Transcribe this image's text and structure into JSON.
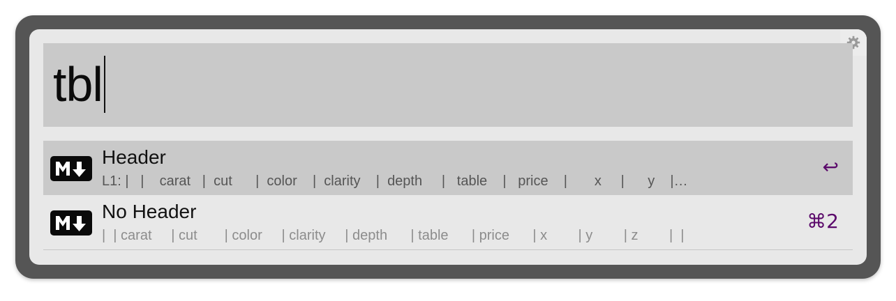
{
  "search": {
    "query": "tbl"
  },
  "settings_icon": "gear-icon",
  "results": [
    {
      "icon": "markdown-icon",
      "title": "Header",
      "subtitle": "L1: |   |    carat   |  cut      |  color    |  clarity    |  depth     |   table    |   price    |       x     |      y    |…",
      "shortcut": "↩",
      "selected": true
    },
    {
      "icon": "markdown-icon",
      "title": "No Header",
      "subtitle": "|  | carat     | cut       | color     | clarity     | depth      | table      | price      | x        | y        | z        |  |",
      "shortcut": "⌘2",
      "selected": false
    }
  ],
  "colors": {
    "selection_background": "#c9c9c9",
    "panel_background": "#e8e8e8",
    "shortcut_color": "#5b0a6b"
  }
}
